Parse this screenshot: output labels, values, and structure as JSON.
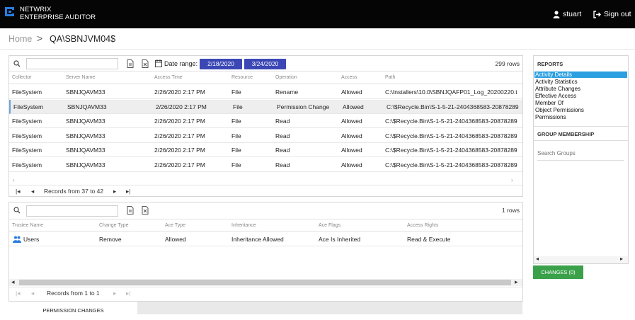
{
  "header": {
    "brand_line1": "NETWRIX",
    "brand_line2": "ENTERPRISE AUDITOR",
    "user_name": "stuart",
    "sign_out_label": "Sign out",
    "icons": {
      "logo": "netwrix-logo",
      "user": "user-icon",
      "signout": "sign-out-icon"
    }
  },
  "breadcrumb": {
    "home": "Home",
    "separator": ">",
    "current": "QA\\SBNJVM04$"
  },
  "activity": {
    "date_range_label": "Date range:",
    "date_from": "2/18/2020",
    "date_to": "3/24/2020",
    "row_count": "299 rows",
    "columns": [
      "Collector",
      "Server Name",
      "Access Time",
      "Resource",
      "Operation",
      "Access",
      "Path"
    ],
    "rows": [
      [
        "FileSystem",
        "SBNJQAVM33",
        "2/26/2020 2:17 PM",
        "File",
        "Rename",
        "Allowed",
        "C:\\Installers\\10.0\\SBNJQAFP01_Log_20200220.t"
      ],
      [
        "FileSystem",
        "SBNJQAVM33",
        "2/26/2020 2:17 PM",
        "File",
        "Permission Change",
        "Allowed",
        "C:\\$Recycle.Bin\\S-1-5-21-2404368583-20878289"
      ],
      [
        "FileSystem",
        "SBNJQAVM33",
        "2/26/2020 2:17 PM",
        "File",
        "Read",
        "Allowed",
        "C:\\$Recycle.Bin\\S-1-5-21-2404368583-20878289"
      ],
      [
        "FileSystem",
        "SBNJQAVM33",
        "2/26/2020 2:17 PM",
        "File",
        "Read",
        "Allowed",
        "C:\\$Recycle.Bin\\S-1-5-21-2404368583-20878289"
      ],
      [
        "FileSystem",
        "SBNJQAVM33",
        "2/26/2020 2:17 PM",
        "File",
        "Read",
        "Allowed",
        "C:\\$Recycle.Bin\\S-1-5-21-2404368583-20878289"
      ],
      [
        "FileSystem",
        "SBNJQAVM33",
        "2/26/2020 2:17 PM",
        "File",
        "Read",
        "Allowed",
        "C:\\$Recycle.Bin\\S-1-5-21-2404368583-20878289"
      ]
    ],
    "selected_row": 1,
    "records_label": "Records from 37 to 42"
  },
  "permissions": {
    "row_count": "1 rows",
    "columns": [
      "Trustee Name",
      "Change Type",
      "Ace Type",
      "Inheritance",
      "Ace Flags",
      "Access Rights"
    ],
    "rows": [
      [
        "Users",
        "Remove",
        "Allowed",
        "Inheritance Allowed",
        "Ace Is Inherited",
        "Read & Execute"
      ]
    ],
    "records_label": "Records from 1 to 1",
    "tab_label": "PERMISSION CHANGES"
  },
  "reports": {
    "title": "REPORTS",
    "items": [
      "Activity Details",
      "Activity Statistics",
      "Attribute Changes",
      "Effective Access",
      "Member Of",
      "Object Permissions",
      "Permissions"
    ],
    "active_index": 0,
    "group_title": "GROUP MEMBERSHIP",
    "group_search_placeholder": "Search Groups",
    "changes_button": "CHANGES (0)"
  },
  "colors": {
    "topbar": "#050505",
    "date_button": "#3a47b5",
    "active_report": "#2b9fe0",
    "changes_button": "#3aa14a"
  }
}
